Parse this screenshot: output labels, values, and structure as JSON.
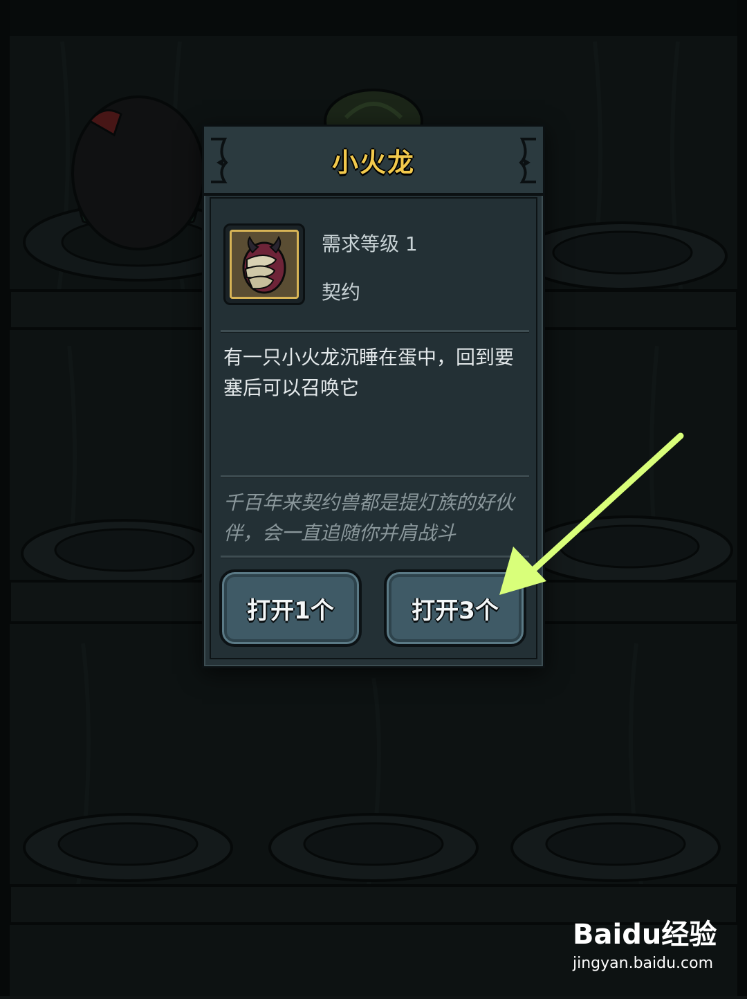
{
  "modal": {
    "title": "小火龙",
    "required_level": "需求等级 1",
    "item_type": "契约",
    "description": "有一只小火龙沉睡在蛋中，回到要塞后可以召唤它",
    "lore": "千百年来契约兽都是提灯族的好伙伴，会一直追随你并肩战斗",
    "buttons": {
      "open_one": "打开1个",
      "open_three": "打开3个"
    }
  },
  "watermark": {
    "brand": "Baidu经验",
    "url": "jingyan.baidu.com"
  },
  "colors": {
    "title": "#f2c94c",
    "arrow": "#d9ff7a",
    "panel": "#263338"
  },
  "icons": {
    "item": "dragon-egg-icon",
    "pointer": "arrow-icon"
  }
}
